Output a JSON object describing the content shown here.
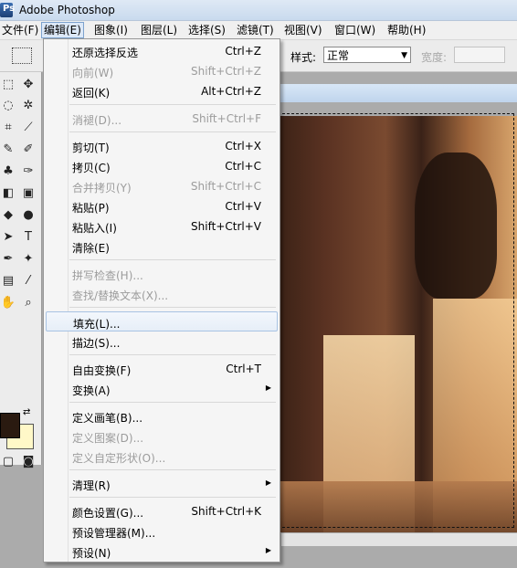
{
  "window": {
    "title": "Adobe Photoshop"
  },
  "menubar": [
    {
      "label": "文件(F)",
      "active": false
    },
    {
      "label": "编辑(E)",
      "active": true
    },
    {
      "label": "图象(I)",
      "active": false
    },
    {
      "label": "图层(L)",
      "active": false
    },
    {
      "label": "选择(S)",
      "active": false
    },
    {
      "label": "滤镜(T)",
      "active": false
    },
    {
      "label": "视图(V)",
      "active": false
    },
    {
      "label": "窗口(W)",
      "active": false
    },
    {
      "label": "帮助(H)",
      "active": false
    }
  ],
  "options": {
    "style_label": "样式:",
    "style_value": "正常",
    "width_label": "宽度:"
  },
  "edit_menu": {
    "items": [
      {
        "label": "还原选择反选",
        "shortcut": "Ctrl+Z",
        "disabled": false
      },
      {
        "label": "向前(W)",
        "shortcut": "Shift+Ctrl+Z",
        "disabled": true
      },
      {
        "label": "返回(K)",
        "shortcut": "Alt+Ctrl+Z",
        "disabled": false
      },
      {
        "label": "消褪(D)...",
        "shortcut": "Shift+Ctrl+F",
        "disabled": true
      },
      {
        "label": "剪切(T)",
        "shortcut": "Ctrl+X",
        "disabled": false
      },
      {
        "label": "拷贝(C)",
        "shortcut": "Ctrl+C",
        "disabled": false
      },
      {
        "label": "合并拷贝(Y)",
        "shortcut": "Shift+Ctrl+C",
        "disabled": true
      },
      {
        "label": "粘贴(P)",
        "shortcut": "Ctrl+V",
        "disabled": false
      },
      {
        "label": "粘贴入(I)",
        "shortcut": "Shift+Ctrl+V",
        "disabled": false
      },
      {
        "label": "清除(E)",
        "shortcut": "",
        "disabled": false
      },
      {
        "label": "拼写检查(H)...",
        "shortcut": "",
        "disabled": true
      },
      {
        "label": "查找/替换文本(X)...",
        "shortcut": "",
        "disabled": true
      },
      {
        "label": "填充(L)...",
        "shortcut": "",
        "disabled": false,
        "highlighted": true
      },
      {
        "label": "描边(S)...",
        "shortcut": "",
        "disabled": false
      },
      {
        "label": "自由变换(F)",
        "shortcut": "Ctrl+T",
        "disabled": false
      },
      {
        "label": "变换(A)",
        "shortcut": "",
        "disabled": false,
        "submenu": true
      },
      {
        "label": "定义画笔(B)...",
        "shortcut": "",
        "disabled": false
      },
      {
        "label": "定义图案(D)...",
        "shortcut": "",
        "disabled": true
      },
      {
        "label": "定义自定形状(O)...",
        "shortcut": "",
        "disabled": true
      },
      {
        "label": "清理(R)",
        "shortcut": "",
        "disabled": false,
        "submenu": true
      },
      {
        "label": "颜色设置(G)...",
        "shortcut": "Shift+Ctrl+K",
        "disabled": false
      },
      {
        "label": "预设管理器(M)...",
        "shortcut": "",
        "disabled": false
      },
      {
        "label": "预设(N)",
        "shortcut": "",
        "disabled": false,
        "submenu": true
      }
    ]
  },
  "colors": {
    "foreground": "#2a1a10",
    "background": "#fff8c8",
    "menu_highlight": "#e6eef8"
  }
}
